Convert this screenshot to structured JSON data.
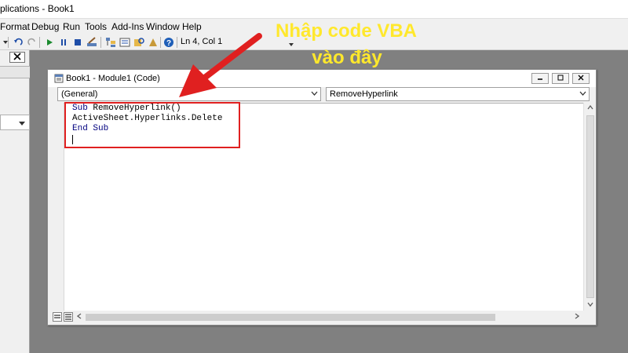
{
  "app": {
    "title_partial": "plications - Book1"
  },
  "menu": {
    "items": [
      "Format",
      "Debug",
      "Run",
      "Tools",
      "Add-Ins",
      "Window",
      "Help"
    ]
  },
  "toolbar": {
    "cursor_position": "Ln 4, Col 1"
  },
  "code_window": {
    "title": "Book1 - Module1 (Code)",
    "object_dropdown": "(General)",
    "procedure_dropdown": "RemoveHyperlink",
    "code_lines": [
      {
        "kw": "Sub",
        "rest": " RemoveHyperlink()"
      },
      {
        "kw": "",
        "rest": "ActiveSheet.Hyperlinks.Delete"
      },
      {
        "kw": "End Sub",
        "rest": ""
      }
    ]
  },
  "annotation": {
    "line1": "Nhập code VBA",
    "line2": "vào đây"
  },
  "colors": {
    "annotation_text": "#ffe82c",
    "annotation_arrow": "#e02020",
    "keyword": "#00007f",
    "background": "#808080"
  },
  "icons": [
    "undo-icon",
    "redo-icon",
    "run-icon",
    "pause-icon",
    "stop-icon",
    "design-mode-icon",
    "project-explorer-icon",
    "properties-icon",
    "object-browser-icon",
    "toolbox-icon",
    "help-icon"
  ]
}
